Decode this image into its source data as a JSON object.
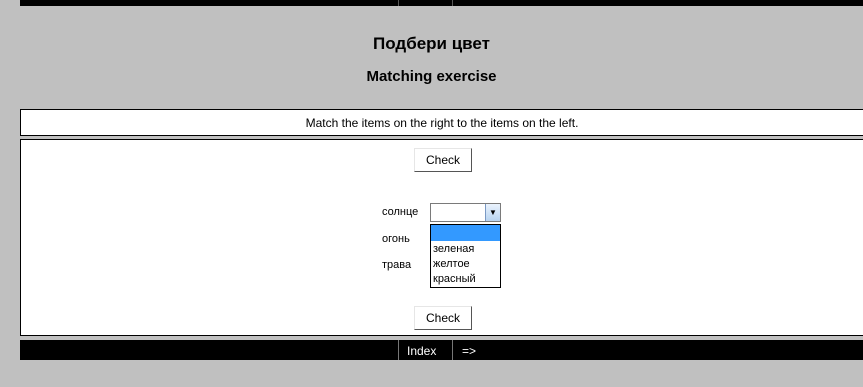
{
  "header": {
    "title": "Подбери цвет",
    "subtitle": "Matching exercise"
  },
  "instructions": "Match the items on the right to the items on the left.",
  "buttons": {
    "check_top": "Check",
    "check_bottom": "Check"
  },
  "items": [
    {
      "label": "солнце"
    },
    {
      "label": "огонь"
    },
    {
      "label": "трава"
    }
  ],
  "dropdown": {
    "selected_value": "",
    "options": [
      "",
      "зеленая",
      "желтое",
      "красный"
    ],
    "highlight_color": "#3399ff"
  },
  "nav": {
    "index_label": "Index",
    "next_label": "=>"
  },
  "colors": {
    "page_background": "#c0c0c0",
    "bar_background": "#000000",
    "panel_background": "#ffffff"
  }
}
